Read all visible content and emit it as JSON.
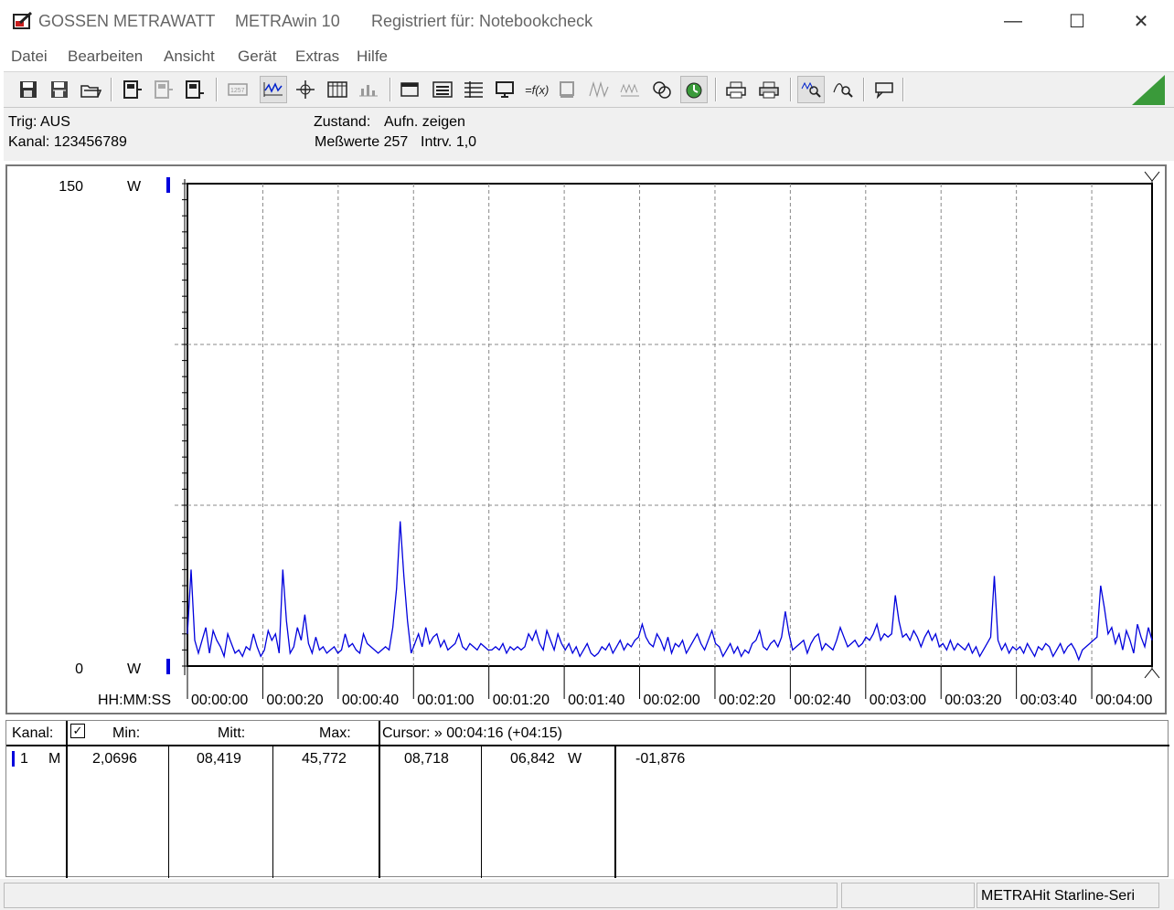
{
  "window": {
    "brand": "GOSSEN METRAWATT",
    "app_name": "METRAwin 10",
    "registration": "Registriert für: Notebookcheck",
    "minimize": "—",
    "maximize": "☐",
    "close": "✕"
  },
  "menu": [
    "Datei",
    "Bearbeiten",
    "Ansicht",
    "Gerät",
    "Extras",
    "Hilfe"
  ],
  "toolbar": {
    "icons": [
      "save-icon",
      "save-as-icon",
      "open-folder-icon",
      "device-read-icon",
      "device-disabled-icon",
      "device-icon",
      "counter-icon",
      "waveform-display-icon",
      "cursor-icon",
      "table-icon",
      "bar-view-icon",
      "window-icon",
      "list-window-icon",
      "spreadsheet-icon",
      "monitor-icon",
      "formula-icon",
      "memory-icon",
      "signal-icon",
      "signal-grid-icon",
      "channels-icon",
      "trigger-icon",
      "printer-icon",
      "print-all-icon",
      "zoom-waveform-icon",
      "zoom-out-icon",
      "comment-icon"
    ]
  },
  "info": {
    "trig": "Trig: AUS",
    "kanal": "Kanal: 123456789",
    "zustand_label": "Zustand:",
    "zustand_value": "Aufn. zeigen",
    "messwerte": "Meßwerte 257",
    "intervall": "Intrv. 1,0"
  },
  "chart_data": {
    "type": "line",
    "y_top_label": "150",
    "y_bottom_label": "0",
    "y_unit": "W",
    "ylim": [
      0,
      150
    ],
    "x_axis_label": "HH:MM:SS",
    "x_tick_labels": [
      "00:00:00",
      "00:00:20",
      "00:00:40",
      "00:01:00",
      "00:01:20",
      "00:01:40",
      "00:02:00",
      "00:02:20",
      "00:02:40",
      "00:03:00",
      "00:03:20",
      "00:03:40",
      "00:04:00"
    ],
    "xlim_seconds": [
      0,
      256
    ],
    "grid": true,
    "line_color": "#0000dd",
    "series": [
      {
        "values_w": [
          10,
          30,
          8,
          4,
          8,
          12,
          4,
          11,
          8,
          6,
          3,
          10,
          7,
          4,
          5,
          3,
          6,
          5,
          10,
          6,
          3,
          5,
          11,
          8,
          10,
          4,
          30,
          14,
          4,
          6,
          12,
          8,
          16,
          7,
          4,
          9,
          5,
          6,
          4,
          5,
          6,
          4,
          5,
          10,
          6,
          7,
          5,
          4,
          10,
          7,
          6,
          5,
          4,
          5,
          6,
          5,
          12,
          24,
          45,
          28,
          14,
          4,
          7,
          10,
          6,
          12,
          7,
          9,
          10,
          6,
          8,
          5,
          6,
          7,
          10,
          6,
          5,
          7,
          6,
          5,
          7,
          6,
          5,
          5,
          6,
          5,
          7,
          4,
          6,
          5,
          6,
          5,
          6,
          10,
          8,
          11,
          7,
          5,
          11,
          8,
          5,
          10,
          7,
          5,
          7,
          4,
          6,
          3,
          5,
          7,
          4,
          3,
          4,
          6,
          5,
          7,
          4,
          6,
          8,
          5,
          7,
          6,
          8,
          9,
          13,
          9,
          7,
          6,
          10,
          8,
          5,
          9,
          4,
          7,
          6,
          8,
          4,
          6,
          8,
          10,
          7,
          5,
          8,
          11,
          7,
          6,
          3,
          5,
          7,
          4,
          6,
          3,
          5,
          4,
          7,
          8,
          11,
          6,
          5,
          7,
          8,
          6,
          9,
          17,
          10,
          5,
          6,
          7,
          8,
          4,
          7,
          9,
          10,
          5,
          7,
          6,
          5,
          8,
          12,
          9,
          6,
          7,
          8,
          6,
          7,
          9,
          8,
          10,
          13,
          8,
          10,
          9,
          10,
          22,
          14,
          9,
          10,
          8,
          11,
          9,
          6,
          9,
          11,
          8,
          10,
          6,
          7,
          5,
          8,
          5,
          7,
          6,
          5,
          7,
          4,
          6,
          3,
          5,
          7,
          9,
          28,
          8,
          5,
          7,
          4,
          6,
          5,
          6,
          4,
          7,
          5,
          3,
          6,
          5,
          7,
          6,
          3,
          5,
          7,
          4,
          6,
          7,
          5,
          2,
          5,
          6,
          7,
          8,
          9,
          25,
          18,
          10,
          12,
          7,
          10,
          5,
          11,
          8,
          4,
          13,
          9,
          6,
          12,
          8
        ]
      }
    ]
  },
  "table": {
    "headers": {
      "kanal": "Kanal:",
      "min": "Min:",
      "mitt": "Mitt:",
      "max": "Max:",
      "cursor": "Cursor: » 00:04:16 (+04:15)"
    },
    "rows": [
      {
        "channel": "1",
        "mode": "M",
        "min": "2,0696",
        "mitt": "08,419",
        "max": "45,772",
        "val1": "08,718",
        "val2": "06,842",
        "unit": "W",
        "diff": "-01,876"
      }
    ]
  },
  "status": {
    "device": "METRAHit Starline-Seri"
  }
}
